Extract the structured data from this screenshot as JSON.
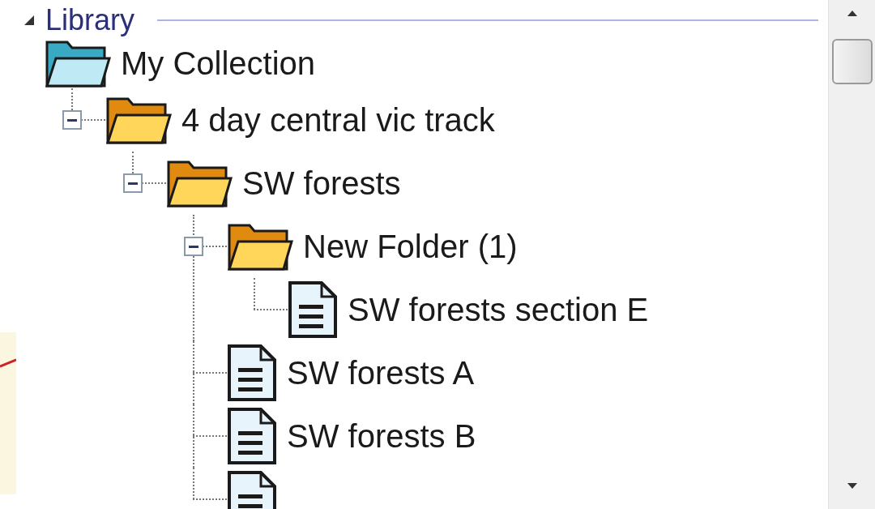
{
  "header": {
    "title": "Library",
    "expanded": true
  },
  "tree": [
    {
      "kind": "collection",
      "label": "My Collection",
      "children": [
        {
          "kind": "folder",
          "label": "4 day central vic track",
          "expanded": true,
          "children": [
            {
              "kind": "folder",
              "label": "SW forests",
              "expanded": true,
              "children": [
                {
                  "kind": "folder",
                  "label": "New Folder (1)",
                  "expanded": true,
                  "children": [
                    {
                      "kind": "document",
                      "label": "SW forests section E"
                    }
                  ]
                },
                {
                  "kind": "document",
                  "label": "SW forests A"
                },
                {
                  "kind": "document",
                  "label": "SW forests B"
                },
                {
                  "kind": "document"
                }
              ]
            }
          ]
        }
      ]
    }
  ]
}
